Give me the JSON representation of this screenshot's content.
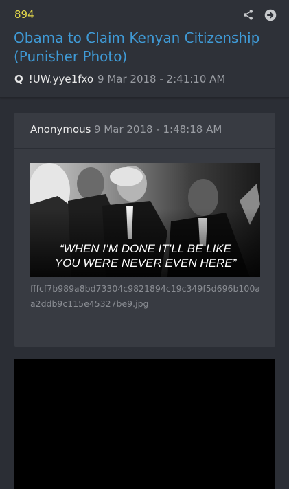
{
  "post": {
    "number": "894",
    "title": "Obama to Claim Kenyan Citizenship (Punisher Photo)",
    "author_marker": "Q",
    "tripcode": "!UW.yye1fxo",
    "timestamp": "9 Mar 2018 - 2:41:10 AM"
  },
  "quoted": {
    "name": "Anonymous",
    "timestamp": "9 Mar 2018 - 1:48:18 AM",
    "image_caption_line1": "“WHEN I’M DONE IT’LL BE LIKE",
    "image_caption_line2": "YOU WERE NEVER EVEN HERE”",
    "filename": "fffcf7b989a8bd73304c9821894c19c349f5d696b100aa2ddb9c115e45327be9.jpg"
  },
  "icons": {
    "share": "share-icon",
    "next": "arrow-right-circle-icon"
  },
  "colors": {
    "post_number": "#e4d84a",
    "title": "#3f9ad6",
    "background": "#2b2e35",
    "card": "#383b42"
  }
}
